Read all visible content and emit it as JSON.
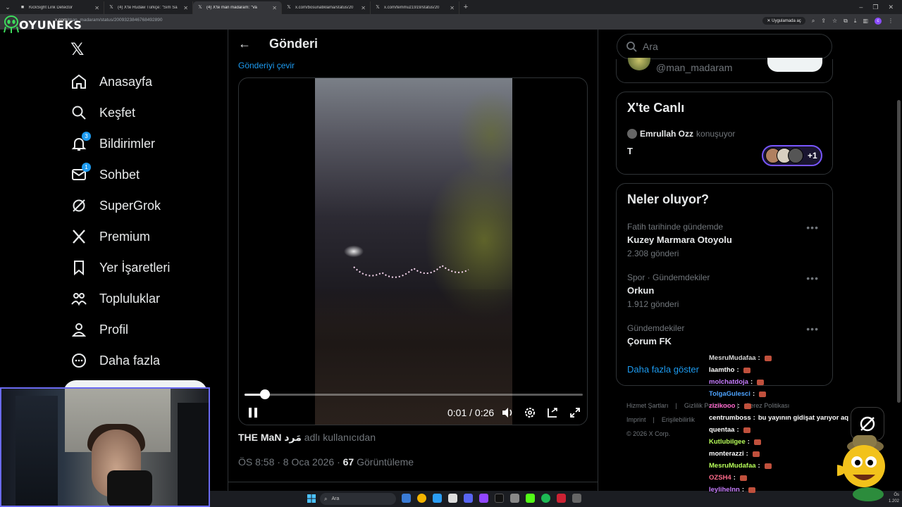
{
  "browser": {
    "tabs": [
      {
        "title": "KickSight Link Detector",
        "icon": "kick-icon",
        "active": false
      },
      {
        "title": "(4) X'te Rudaw Türkçe: \"Sım Sa",
        "icon": "x-icon",
        "active": false
      },
      {
        "title": "(4) X'te man madaram: \"Va",
        "icon": "x-icon",
        "active": true
      },
      {
        "title": "x.com/bosunatiklama/status/20",
        "icon": "x-icon",
        "active": false
      },
      {
        "title": "x.com/temmuz1919/status/20",
        "icon": "x-icon",
        "active": false
      }
    ],
    "url_prefix": "x.com",
    "url_rest": "/man_madaram/status/2009323846768492890",
    "open_in_app": "Uygulamada aç"
  },
  "overlay": {
    "brand": "OYUNEKS"
  },
  "sidebar": {
    "items": [
      {
        "label": "Anasayfa",
        "icon": "home-icon",
        "badge": ""
      },
      {
        "label": "Keşfet",
        "icon": "search-icon",
        "badge": ""
      },
      {
        "label": "Bildirimler",
        "icon": "bell-icon",
        "badge": "3"
      },
      {
        "label": "Sohbet",
        "icon": "mail-icon",
        "badge": "1"
      },
      {
        "label": "SuperGrok",
        "icon": "grok-icon",
        "badge": ""
      },
      {
        "label": "Premium",
        "icon": "x-icon",
        "badge": ""
      },
      {
        "label": "Yer İşaretleri",
        "icon": "bookmark-icon",
        "badge": ""
      },
      {
        "label": "Topluluklar",
        "icon": "communities-icon",
        "badge": ""
      },
      {
        "label": "Profil",
        "icon": "profile-icon",
        "badge": ""
      },
      {
        "label": "Daha fazla",
        "icon": "more-circle-icon",
        "badge": ""
      }
    ]
  },
  "main": {
    "title": "Gönderi",
    "translate_link": "Gönderiyi çevir",
    "video": {
      "current_time": "0:01",
      "duration": "0:26",
      "progress": 0.06
    },
    "author_name": "THE MaN مَرد",
    "author_suffix": "adlı kullanıcıdan",
    "timestamp": "ÖS 8:58 · 8 Oca 2026 · ",
    "views_count": "67",
    "views_label": " Görüntüleme"
  },
  "right": {
    "search_placeholder": "Ara",
    "who_handle": "@man_madaram",
    "live": {
      "title": "X'te Canlı",
      "host": "Emrullah Ozz",
      "host_status": "konuşuyor",
      "topic": "T",
      "extra": "+1"
    },
    "trends": {
      "title": "Neler oluyor?",
      "items": [
        {
          "context": "Fatih tarihinde gündemde",
          "name": "Kuzey Marmara Otoyolu",
          "count": "2.308 gönderi"
        },
        {
          "context": "Spor · Gündemdekiler",
          "name": "Orkun",
          "count": "1.912 gönderi"
        },
        {
          "context": "Gündemdekiler",
          "name": "Çorum FK",
          "count": ""
        }
      ],
      "show_more": "Daha fazla göster"
    },
    "footer": {
      "links_row1": [
        "Hizmet Şartları",
        "Gizlilik Politikası",
        "Çerez Politikası"
      ],
      "links_row2": [
        "Imprint",
        "Erişilebilirlik"
      ],
      "copyright": "© 2026 X Corp."
    }
  },
  "chat": [
    {
      "user": "MesruMudafaa",
      "color": "#d6d6d6",
      "msg": ""
    },
    {
      "user": "Iaamtho",
      "color": "#ffffff",
      "msg": ""
    },
    {
      "user": "molchatdoja",
      "color": "#c77dff",
      "msg": ""
    },
    {
      "user": "TolgaGulesci",
      "color": "#4da3ff",
      "msg": ""
    },
    {
      "user": "zizikooo",
      "color": "#ff66cc",
      "msg": ""
    },
    {
      "user": "centrumboss",
      "color": "#ffffff",
      "msg": "bu yayının gidişat yarıyor aq"
    },
    {
      "user": "quentaa",
      "color": "#ffffff",
      "msg": ""
    },
    {
      "user": "Kutlubilgee",
      "color": "#b8ff5a",
      "msg": ""
    },
    {
      "user": "monterazzi",
      "color": "#ffffff",
      "msg": ""
    },
    {
      "user": "MesruMudafaa",
      "color": "#b8ff5a",
      "msg": ""
    },
    {
      "user": "OZSH4",
      "color": "#ff6b8b",
      "msg": ""
    },
    {
      "user": "leylihelnn",
      "color": "#c77dff",
      "msg": ""
    }
  ],
  "taskbar": {
    "search_placeholder": "Ara",
    "clock_time": "Ös",
    "clock_date": "1.202"
  }
}
